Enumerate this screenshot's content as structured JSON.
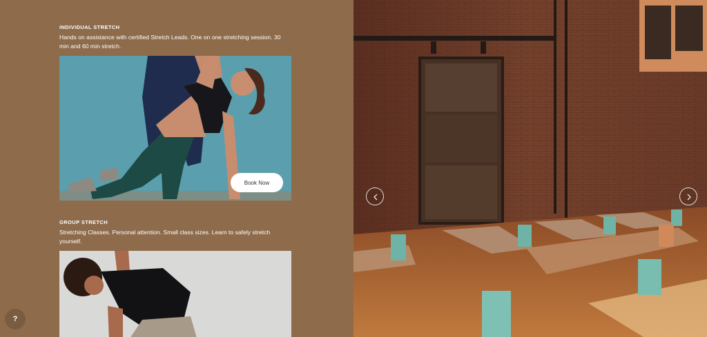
{
  "services": [
    {
      "title": "INDIVIDUAL STRETCH",
      "description": "Hands on assistance with certified Stretch Leads. One on one stretching session. 30 min and 60 min stretch.",
      "button_label": "Book Now"
    },
    {
      "title": "GROUP STRETCH",
      "description": "Stretching Classes. Personal attention. Small class sizes. Learn to safely stretch yourself."
    }
  ],
  "help": {
    "label": "?"
  },
  "carousel": {
    "prev_icon": "chevron-left-icon",
    "next_icon": "chevron-right-icon"
  },
  "colors": {
    "panel_bg": "#8d6b4b",
    "accent_text": "#ffffff",
    "photo_one_bg": "#5b9fae",
    "photo_two_bg": "#d9d9d7"
  }
}
